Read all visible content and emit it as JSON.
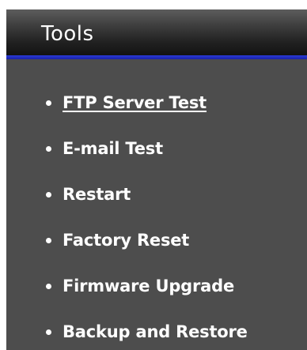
{
  "panel": {
    "title": "Tools",
    "accent_color": "#1e2cc4",
    "background_color": "#4d4d4d",
    "items": [
      {
        "label": "FTP Server Test",
        "active": true
      },
      {
        "label": "E-mail Test",
        "active": false
      },
      {
        "label": "Restart",
        "active": false
      },
      {
        "label": "Factory Reset",
        "active": false
      },
      {
        "label": "Firmware Upgrade",
        "active": false
      },
      {
        "label": "Backup and Restore",
        "active": false
      }
    ]
  }
}
